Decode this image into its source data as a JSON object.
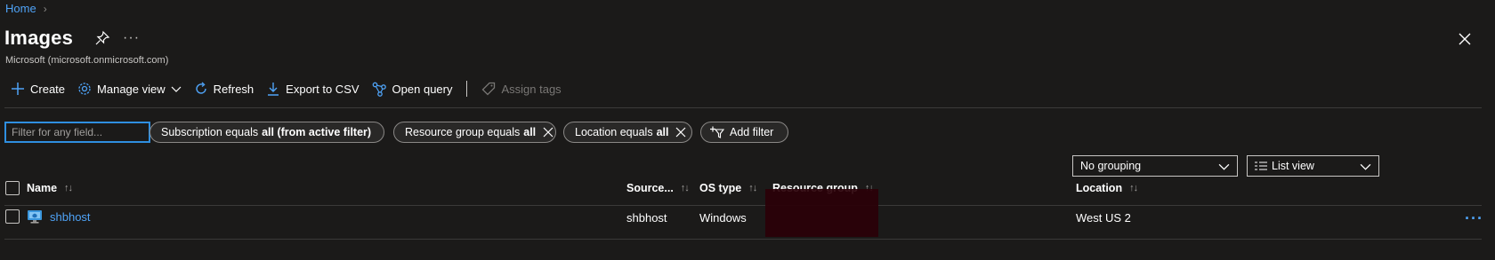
{
  "breadcrumb": {
    "home": "Home",
    "separator": "›"
  },
  "header": {
    "title": "Images",
    "subtitle": "Microsoft (microsoft.onmicrosoft.com)",
    "more": "···"
  },
  "toolbar": {
    "create": "Create",
    "manage_view": "Manage view",
    "refresh": "Refresh",
    "export_csv": "Export to CSV",
    "open_query": "Open query",
    "assign_tags": "Assign tags"
  },
  "filters": {
    "search_placeholder": "Filter for any field...",
    "subscription_prefix": "Subscription equals",
    "subscription_value": "all (from active filter)",
    "resource_group_prefix": "Resource group equals",
    "resource_group_value": "all",
    "location_prefix": "Location equals",
    "location_value": "all",
    "add_filter": "Add filter"
  },
  "view": {
    "grouping": "No grouping",
    "list_view": "List view"
  },
  "table": {
    "columns": [
      "Name",
      "Source...",
      "OS type",
      "Resource group",
      "Location"
    ],
    "sort_indicator": "↑↓",
    "rows": [
      {
        "name": "shbhost",
        "source": "shbhost",
        "os_type": "Windows",
        "resource_group": "",
        "location": "West US 2"
      }
    ],
    "row_more": "···"
  },
  "colors": {
    "background": "#1b1a19",
    "link": "#4fa3f7",
    "focus_border": "#2f8fe0",
    "redaction": "#2a0008"
  }
}
